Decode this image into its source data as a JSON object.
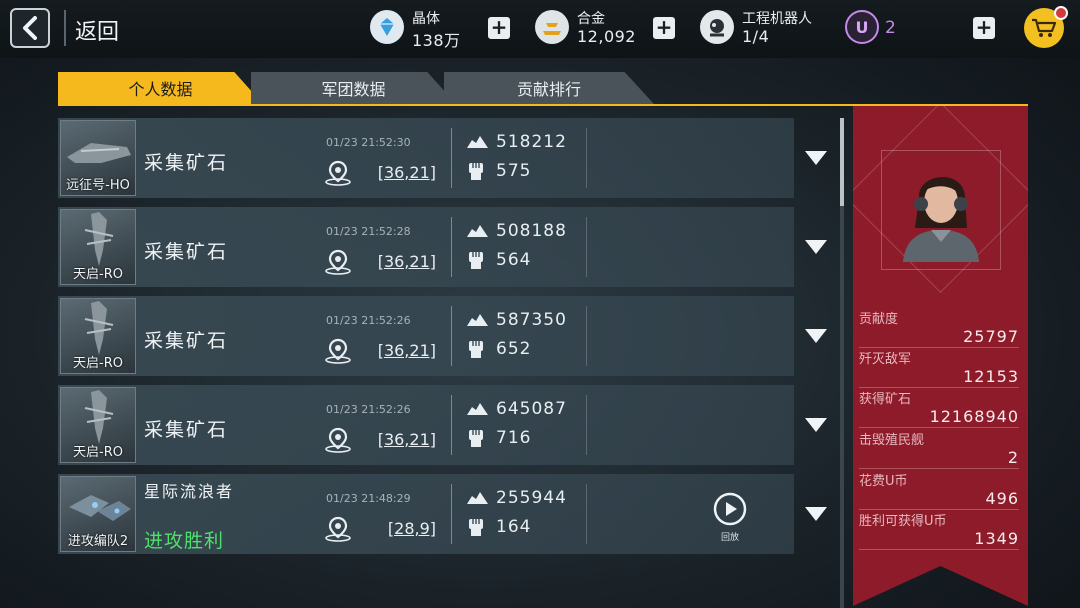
{
  "header": {
    "back_label": "返回",
    "resources": [
      {
        "name": "晶体",
        "value": "138万",
        "icon": "crystal-icon"
      },
      {
        "name": "合金",
        "value": "12,092",
        "icon": "alloy-icon"
      },
      {
        "name": "工程机器人",
        "value": "1/4",
        "icon": "robot-icon"
      }
    ],
    "ucoin": {
      "value": "2",
      "icon": "u-coin-icon"
    }
  },
  "tabs": [
    {
      "label": "个人数据",
      "active": true
    },
    {
      "label": "军团数据",
      "active": false
    },
    {
      "label": "贡献排行",
      "active": false
    }
  ],
  "records": [
    {
      "ship": "远征号-HO",
      "title": "采集矿石",
      "time": "01/23 21:52:30",
      "coord": "[36,21]",
      "stat1": "518212",
      "stat2": "575"
    },
    {
      "ship": "天启-RO",
      "title": "采集矿石",
      "time": "01/23 21:52:28",
      "coord": "[36,21]",
      "stat1": "508188",
      "stat2": "564"
    },
    {
      "ship": "天启-RO",
      "title": "采集矿石",
      "time": "01/23 21:52:26",
      "coord": "[36,21]",
      "stat1": "587350",
      "stat2": "652"
    },
    {
      "ship": "天启-RO",
      "title": "采集矿石",
      "time": "01/23 21:52:26",
      "coord": "[36,21]",
      "stat1": "645087",
      "stat2": "716"
    },
    {
      "ship": "进攻编队2",
      "title": "星际流浪者",
      "result": "进攻胜利",
      "time": "01/23 21:48:29",
      "coord": "[28,9]",
      "stat1": "255944",
      "stat2": "164",
      "replay_label": "回放"
    }
  ],
  "summary": [
    {
      "label": "贡献度",
      "value": "25797"
    },
    {
      "label": "歼灭敌军",
      "value": "12153"
    },
    {
      "label": "获得矿石",
      "value": "12168940"
    },
    {
      "label": "击毁殖民舰",
      "value": "2"
    },
    {
      "label": "花费U币",
      "value": "496"
    },
    {
      "label": "胜利可获得U币",
      "value": "1349"
    }
  ],
  "colors": {
    "accent": "#f5b81d",
    "panel": "#8e1b2a",
    "victory": "#4ee06a"
  }
}
